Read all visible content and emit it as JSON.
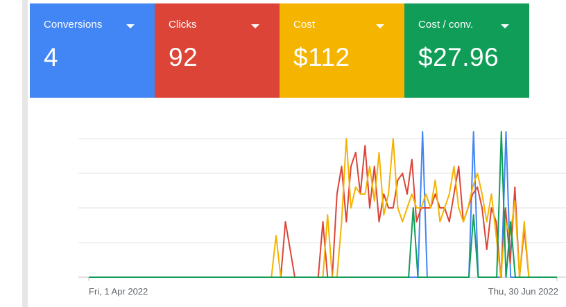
{
  "scorecards": [
    {
      "label": "Conversions",
      "value": "4",
      "color": "#4285f4"
    },
    {
      "label": "Clicks",
      "value": "92",
      "color": "#db4437"
    },
    {
      "label": "Cost",
      "value": "$112",
      "color": "#f4b400"
    },
    {
      "label": "Cost / conv.",
      "value": "$27.96",
      "color": "#0f9d58"
    }
  ],
  "chart_data": {
    "type": "line",
    "x_start": "Fri, 1 Apr 2022",
    "x_end": "Thu, 30 Jun 2022",
    "grid": true,
    "legend": "none",
    "y_normalized": true,
    "series": [
      {
        "color": "#4285f4",
        "values": [
          0,
          0,
          0,
          0,
          0,
          0,
          0,
          0,
          0,
          0,
          0,
          0,
          0,
          0,
          0,
          0,
          0,
          0,
          0,
          0,
          0,
          0,
          0,
          0,
          0,
          0,
          0,
          0,
          0,
          0,
          0,
          0,
          0,
          0,
          0,
          0,
          0,
          0,
          0,
          0,
          0,
          0,
          0,
          0,
          0,
          0,
          0,
          0,
          0,
          0,
          0,
          0,
          0,
          0,
          0,
          0,
          0,
          0,
          0,
          0,
          0,
          0,
          0,
          0,
          0,
          0,
          0,
          0,
          0,
          0,
          0,
          0,
          1.05,
          0,
          0,
          0,
          0,
          0,
          0,
          0,
          0,
          0,
          0,
          1.05,
          0,
          0,
          0,
          0,
          0,
          0,
          1.05,
          0,
          0,
          0,
          0,
          0,
          0,
          0,
          0,
          0,
          0,
          0
        ]
      },
      {
        "color": "#db4437",
        "values": [
          0,
          0,
          0,
          0,
          0,
          0,
          0,
          0,
          0,
          0,
          0,
          0,
          0,
          0,
          0,
          0,
          0,
          0,
          0,
          0,
          0,
          0,
          0,
          0,
          0,
          0,
          0,
          0,
          0,
          0,
          0,
          0,
          0,
          0,
          0,
          0,
          0,
          0,
          0,
          0,
          0,
          0,
          0.4,
          0.2,
          0,
          0,
          0,
          0,
          0,
          0,
          0.4,
          0,
          0,
          0.6,
          0.8,
          0.4,
          0.8,
          0.9,
          0.6,
          0.95,
          0.5,
          0.8,
          0.4,
          0.6,
          0.5,
          0.5,
          0.7,
          0.75,
          0.6,
          0.85,
          0.4,
          0.5,
          0.5,
          0.5,
          0.6,
          0.5,
          0.5,
          0.4,
          0.6,
          0.8,
          0.4,
          0.5,
          0.6,
          0.65,
          0.5,
          0.2,
          0.5,
          0.4,
          0,
          0.5,
          0.1,
          0.65,
          0,
          0.35,
          0,
          0,
          0,
          0,
          0,
          0,
          0
        ]
      },
      {
        "color": "#f4b400",
        "values": [
          0,
          0,
          0,
          0,
          0,
          0,
          0,
          0,
          0,
          0,
          0,
          0,
          0,
          0,
          0,
          0,
          0,
          0,
          0,
          0,
          0,
          0,
          0,
          0,
          0,
          0,
          0,
          0,
          0,
          0,
          0,
          0,
          0,
          0,
          0,
          0,
          0,
          0,
          0,
          0,
          0.3,
          0,
          0,
          0,
          0,
          0,
          0,
          0,
          0,
          0,
          0,
          0.45,
          0,
          0,
          0.4,
          1.0,
          0.5,
          0.65,
          0.6,
          0.6,
          0.8,
          0.55,
          0.9,
          0.45,
          0.6,
          1.0,
          0.5,
          0.4,
          0.5,
          0.6,
          0.5,
          0.5,
          0.6,
          0.5,
          0.7,
          0.4,
          0.5,
          0.6,
          0.8,
          0.5,
          0.4,
          0.5,
          0.65,
          0.75,
          0.6,
          0.4,
          0.6,
          0.3,
          0,
          0.4,
          0.3,
          0.55,
          0,
          0.4,
          0,
          0,
          0,
          0,
          0,
          0,
          0
        ]
      },
      {
        "color": "#0f9d58",
        "values": [
          0,
          0,
          0,
          0,
          0,
          0,
          0,
          0,
          0,
          0,
          0,
          0,
          0,
          0,
          0,
          0,
          0,
          0,
          0,
          0,
          0,
          0,
          0,
          0,
          0,
          0,
          0,
          0,
          0,
          0,
          0,
          0,
          0,
          0,
          0,
          0,
          0,
          0,
          0,
          0,
          0,
          0,
          0,
          0,
          0,
          0,
          0,
          0,
          0,
          0,
          0,
          0,
          0,
          0,
          0,
          0,
          0,
          0,
          0,
          0,
          0,
          0,
          0,
          0,
          0,
          0,
          0,
          0,
          0,
          0,
          0.5,
          0,
          0,
          0,
          0,
          0,
          0,
          0,
          0,
          0,
          0,
          0,
          0,
          0.45,
          0,
          0,
          0,
          0,
          0,
          1.05,
          0,
          0.4,
          0,
          0,
          0,
          0,
          0,
          0,
          0,
          0,
          0,
          0
        ]
      }
    ]
  }
}
